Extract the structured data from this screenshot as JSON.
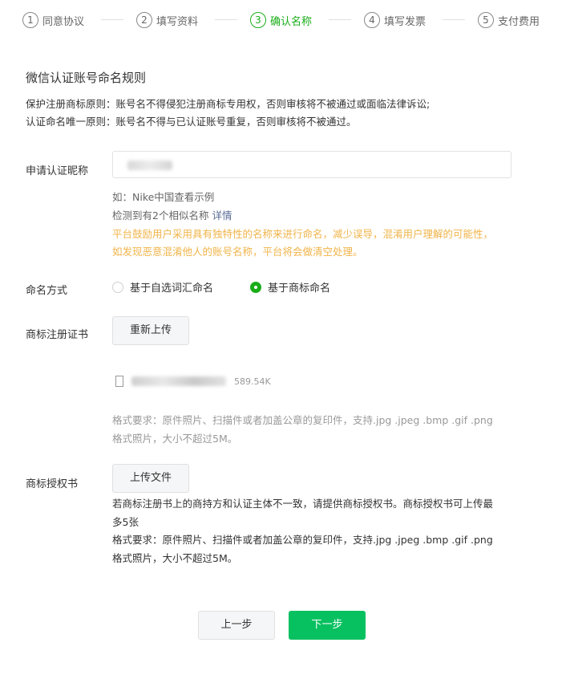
{
  "steps": [
    {
      "num": "1",
      "label": "同意协议",
      "active": false
    },
    {
      "num": "2",
      "label": "填写资料",
      "active": false
    },
    {
      "num": "3",
      "label": "确认名称",
      "active": true
    },
    {
      "num": "4",
      "label": "填写发票",
      "active": false
    },
    {
      "num": "5",
      "label": "支付费用",
      "active": false
    }
  ],
  "rules": {
    "title": "微信认证账号命名规则",
    "line1": "保护注册商标原则：账号名不得侵犯注册商标专用权，否则审核将不被通过或面临法律诉讼;",
    "line2": "认证命名唯一原则：账号名不得与已认证账号重复，否则审核将不被通过。"
  },
  "nickname": {
    "label": "申请认证昵称",
    "example": "如：Nike中国查看示例",
    "similar_prefix": "检测到有2个相似名称",
    "similar_link": "详情",
    "warn1": "平台鼓励用户采用具有独特性的名称来进行命名，减少误导，混淆用户理解的可能性，",
    "warn2": "如发现恶意混淆他人的账号名称，平台将会做清空处理。"
  },
  "naming": {
    "label": "命名方式",
    "option1": "基于自选词汇命名",
    "option2": "基于商标命名",
    "selected": "基于商标命名"
  },
  "trademark_cert": {
    "label": "商标注册证书",
    "button": "重新上传",
    "file_size": "589.54K",
    "req1": "格式要求：原件照片、扫描件或者加盖公章的复印件，支持.jpg .jpeg .bmp .gif .png",
    "req2": "格式照片，大小不超过5M。"
  },
  "trademark_auth": {
    "label": "商标授权书",
    "button": "上传文件",
    "note1": "若商标注册书上的商持方和认证主体不一致，请提供商标授权书。商标授权书可上传最",
    "note2": "多5张",
    "req1": "格式要求：原件照片、扫描件或者加盖公章的复印件，支持.jpg .jpeg .bmp .gif .png",
    "req2": "格式照片，大小不超过5M。"
  },
  "footer": {
    "prev": "上一步",
    "next": "下一步"
  },
  "colors": {
    "accent": "#07c160",
    "step_active": "#1aad19",
    "warning": "#f0b44a"
  }
}
